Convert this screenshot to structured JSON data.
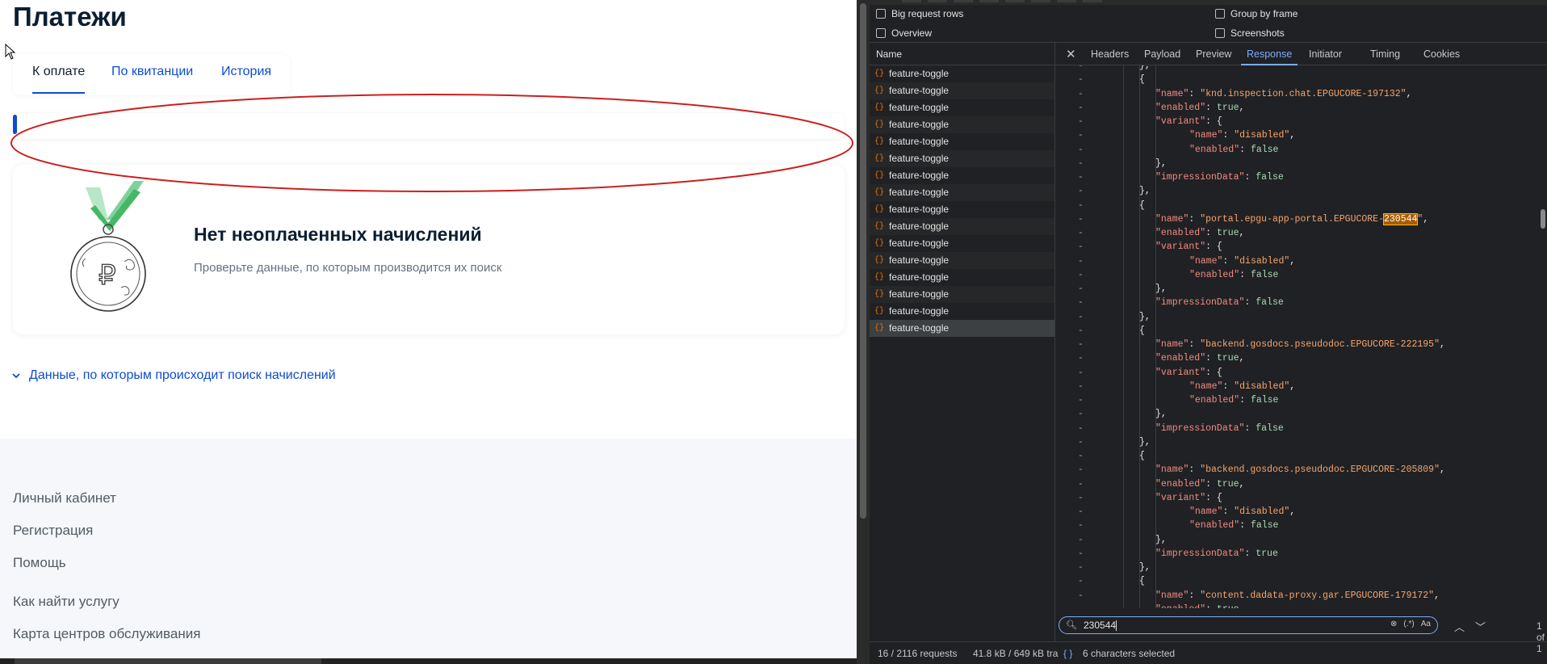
{
  "page": {
    "title": "Платежи",
    "tabs": [
      {
        "label": "К оплате",
        "active": true
      },
      {
        "label": "По квитанции",
        "active": false
      },
      {
        "label": "История",
        "active": false
      }
    ],
    "empty_state": {
      "heading": "Нет неоплаченных начислений",
      "subtext": "Проверьте данные, по которым производится их поиск",
      "icon": "ruble-medal-icon"
    },
    "search_data_link": "Данные, по которым происходит поиск начислений",
    "footer_links": [
      "Личный кабинет",
      "Регистрация",
      "Помощь",
      "Как найти услугу",
      "Карта центров обслуживания"
    ],
    "colors": {
      "link": "#0d4cd3",
      "annotation": "#cc1f1f"
    }
  },
  "devtools": {
    "options": [
      "Big request rows",
      "Group by frame",
      "Overview",
      "Screenshots"
    ],
    "name_column": "Name",
    "detail_tabs": [
      "Headers",
      "Payload",
      "Preview",
      "Response",
      "Initiator",
      "Timing",
      "Cookies"
    ],
    "active_tab": "Response",
    "requests": [
      "feature-toggle",
      "feature-toggle",
      "feature-toggle",
      "feature-toggle",
      "feature-toggle",
      "feature-toggle",
      "feature-toggle",
      "feature-toggle",
      "feature-toggle",
      "feature-toggle",
      "feature-toggle",
      "feature-toggle",
      "feature-toggle",
      "feature-toggle",
      "feature-toggle",
      "feature-toggle"
    ],
    "response_entries": [
      {
        "name": "knd.inspection.chat.EPGUCORE-197132",
        "enabled": "true",
        "variant_name": "disabled",
        "variant_enabled": "false",
        "impressionData": "false"
      },
      {
        "name_pre": "portal.epgu-app-portal.EPGUCORE-",
        "name_hl": "230544",
        "enabled": "true",
        "variant_name": "disabled",
        "variant_enabled": "false",
        "impressionData": "false"
      },
      {
        "name": "backend.gosdocs.pseudodoc.EPGUCORE-222195",
        "enabled": "true",
        "variant_name": "disabled",
        "variant_enabled": "false",
        "impressionData": "false"
      },
      {
        "name": "backend.gosdocs.pseudodoc.EPGUCORE-205809",
        "enabled": "true",
        "variant_name": "disabled",
        "variant_enabled": "false",
        "impressionData": "true"
      },
      {
        "name": "content.dadata-proxy.gar.EPGUCORE-179172",
        "enabled": "true"
      }
    ],
    "search": {
      "value": "230544",
      "match_count": "1 of 1",
      "opt_regex": "(.*)",
      "opt_case": "Aa"
    },
    "status": {
      "requests": "16 / 2116 requests",
      "transferred": "41.8 kB / 649 kB tra",
      "selection": "6 characters selected"
    }
  }
}
